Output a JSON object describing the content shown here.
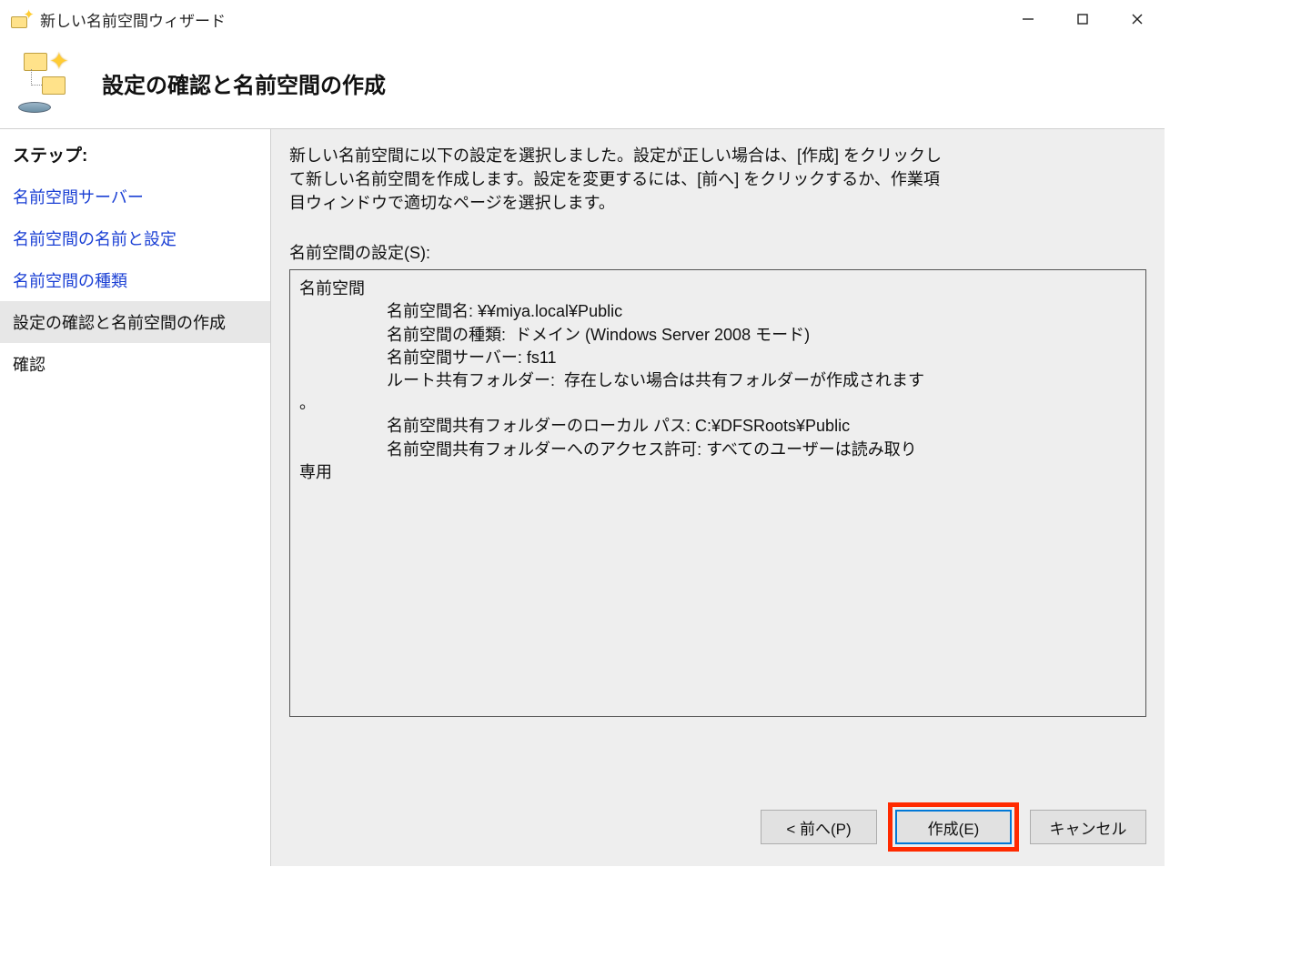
{
  "titlebar": {
    "title": "新しい名前空間ウィザード"
  },
  "header": {
    "title": "設定の確認と名前空間の作成"
  },
  "sidebar": {
    "heading": "ステップ:",
    "items": [
      {
        "label": "名前空間サーバー",
        "state": "link"
      },
      {
        "label": "名前空間の名前と設定",
        "state": "link"
      },
      {
        "label": "名前空間の種類",
        "state": "link"
      },
      {
        "label": "設定の確認と名前空間の作成",
        "state": "selected"
      },
      {
        "label": "確認",
        "state": "plain"
      }
    ]
  },
  "main": {
    "instruction": "新しい名前空間に以下の設定を選択しました。設定が正しい場合は、[作成] をクリックして新しい名前空間を作成します。設定を変更するには、[前へ] をクリックするか、作業項目ウィンドウで適切なページを選択します。",
    "settings_label": "名前空間の設定(S):",
    "settings_heading": "名前空間",
    "detail_name": "名前空間名: ¥¥miya.local¥Public",
    "detail_type": "名前空間の種類:  ドメイン (Windows Server 2008 モード)",
    "detail_server": "名前空間サーバー: fs11",
    "detail_root": "ルート共有フォルダー:  存在しない場合は共有フォルダーが作成されます",
    "detail_period": "。",
    "detail_localpath": "名前空間共有フォルダーのローカル パス: C:¥DFSRoots¥Public",
    "detail_access": "名前空間共有フォルダーへのアクセス許可: すべてのユーザーは読み取り",
    "detail_readonly": "専用"
  },
  "buttons": {
    "back": "< 前へ(P)",
    "create": "作成(E)",
    "cancel": "キャンセル"
  }
}
